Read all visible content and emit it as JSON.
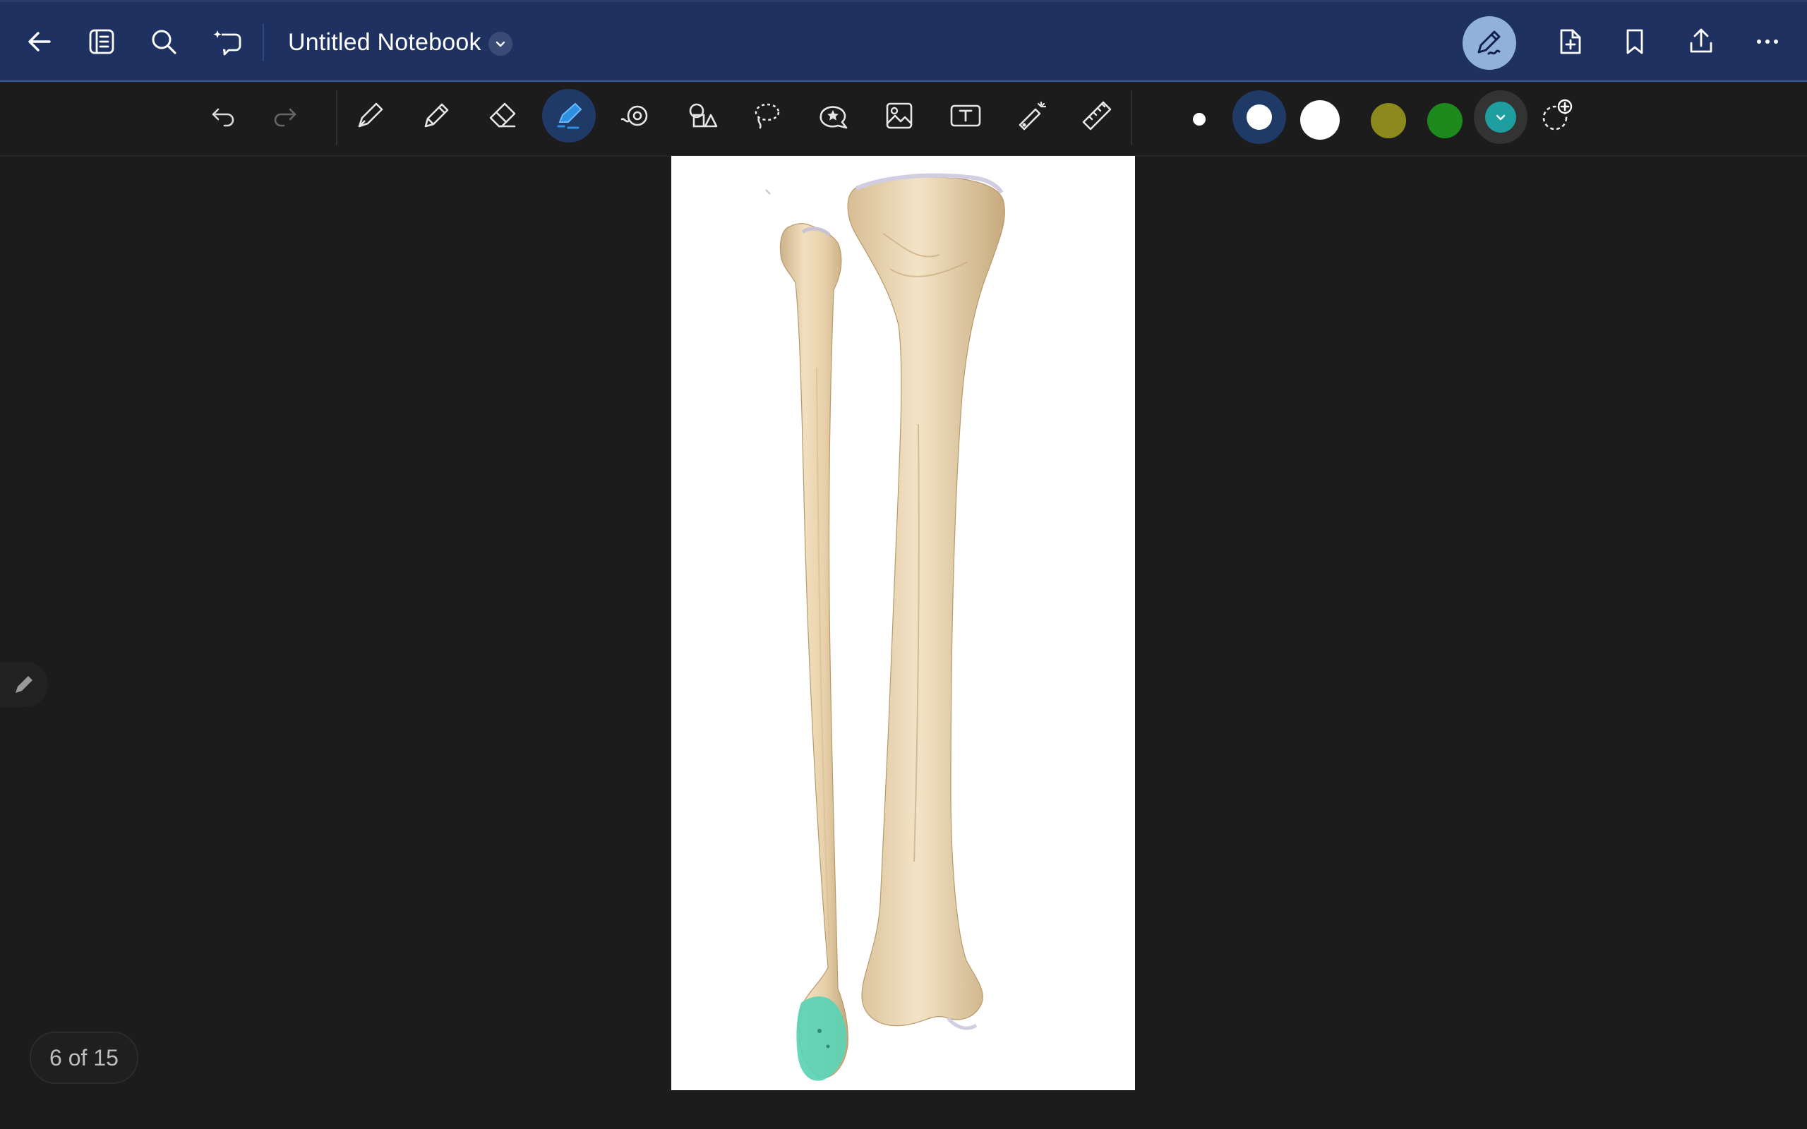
{
  "header": {
    "title": "Untitled Notebook",
    "icons": [
      "back-arrow-icon",
      "notebook-outline-icon",
      "search-icon",
      "ai-chat-icon",
      "title-dropdown-icon",
      "pen-mode-icon",
      "add-page-icon",
      "bookmark-icon",
      "share-icon",
      "more-icon"
    ]
  },
  "toolbar": {
    "tools": [
      "undo",
      "redo",
      "fountain-pen",
      "pencil",
      "eraser",
      "highlighter",
      "shape-recognition",
      "shapes",
      "lasso",
      "sticker",
      "image",
      "text-box",
      "laser-pointer",
      "ruler"
    ],
    "active_tool": "highlighter",
    "stroke_sizes": [
      "small",
      "medium",
      "large"
    ],
    "selected_size": "medium",
    "colors": [
      {
        "name": "white",
        "hex": "#ffffff"
      },
      {
        "name": "olive",
        "hex": "#8c8a1c"
      },
      {
        "name": "green",
        "hex": "#1c8a1c"
      },
      {
        "name": "teal",
        "hex": "#1e9e9e"
      }
    ],
    "selected_color": "teal",
    "accent": "#1f3a66"
  },
  "canvas": {
    "content": "illustration of tibia and fibula bones with teal highlight on the distal fibula",
    "highlight_color": "#5ad3b4"
  },
  "footer": {
    "page_indicator": "6 of 15"
  }
}
